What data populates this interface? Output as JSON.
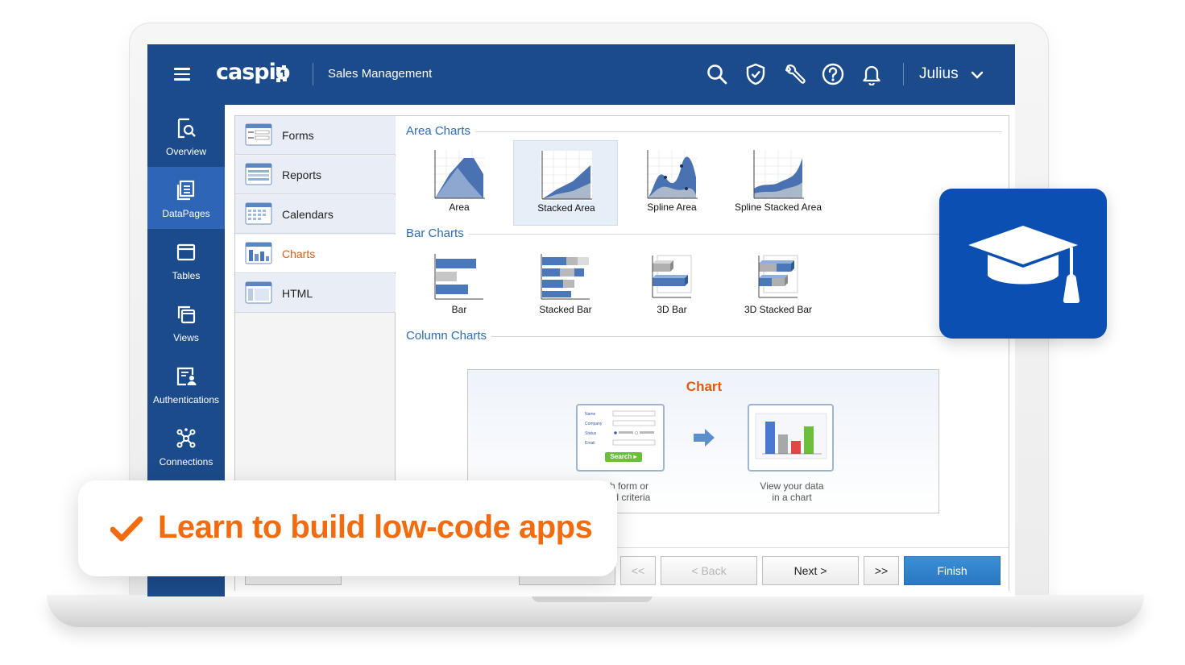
{
  "header": {
    "logo": "caspio",
    "app_title": "Sales Management",
    "user_name": "Julius",
    "icons": [
      "search-icon",
      "shield-icon",
      "wrench-icon",
      "help-icon",
      "bell-icon"
    ]
  },
  "sidebar": {
    "items": [
      {
        "label": "Overview",
        "icon": "overview-icon",
        "active": false
      },
      {
        "label": "DataPages",
        "icon": "datapages-icon",
        "active": true
      },
      {
        "label": "Tables",
        "icon": "table-icon",
        "active": false
      },
      {
        "label": "Views",
        "icon": "views-icon",
        "active": false
      },
      {
        "label": "Authentications",
        "icon": "authentication-icon",
        "active": false
      },
      {
        "label": "Connections",
        "icon": "connections-icon",
        "active": false
      }
    ]
  },
  "wizard": {
    "categories": [
      {
        "label": "Forms",
        "active": false
      },
      {
        "label": "Reports",
        "active": false
      },
      {
        "label": "Calendars",
        "active": false
      },
      {
        "label": "Charts",
        "active": true
      },
      {
        "label": "HTML",
        "active": false
      }
    ],
    "sections": [
      {
        "title": "Area Charts",
        "items": [
          "Area",
          "Stacked Area",
          "Spline Area",
          "Spline Stacked Area"
        ]
      },
      {
        "title": "Bar Charts",
        "items": [
          "Bar",
          "Stacked Bar",
          "3D Bar",
          "3D Stacked Bar"
        ]
      },
      {
        "title": "Column Charts",
        "items": []
      }
    ],
    "selected_item": "Stacked Area",
    "preview": {
      "title": "Chart",
      "caption_left_1": "h form or",
      "caption_left_2": "ed criteria",
      "caption_right_1": "View your data",
      "caption_right_2": "in a chart",
      "mini_form_button": "Search ▸"
    },
    "buttons": {
      "first": "<<",
      "back": "< Back",
      "next": "Next >",
      "last": ">>",
      "finish": "Finish"
    }
  },
  "callout": {
    "text": "Learn to build low-code apps"
  },
  "colors": {
    "nav_blue": "#1c4b8c",
    "nav_active": "#2e65b5",
    "accent_orange": "#f26b0f",
    "badge_blue": "#0a4fb1",
    "finish_blue": "#2a78c0"
  }
}
